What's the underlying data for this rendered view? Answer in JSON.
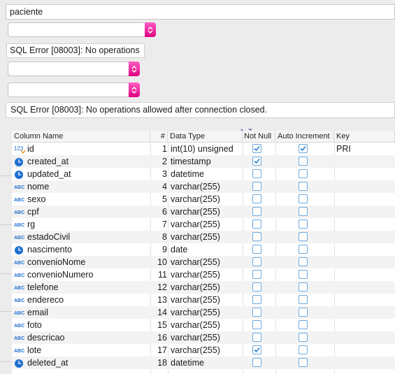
{
  "table_name_field": {
    "value": "paciente"
  },
  "combo1": {
    "value": ""
  },
  "error_short": {
    "text": "SQL Error [08003]: No operations"
  },
  "combo2": {
    "value": ""
  },
  "combo3": {
    "value": ""
  },
  "error_full": {
    "text": "SQL Error [08003]: No operations allowed after connection closed."
  },
  "grid": {
    "headers": {
      "name": "Column Name",
      "num": "#",
      "type": "Data Type",
      "not_null": "Not Null",
      "auto_increment": "Auto Increment",
      "key": "Key"
    },
    "rows": [
      {
        "name": "id",
        "num": "1",
        "type": "int(10) unsigned",
        "icon": "number-type-icon",
        "not_null": true,
        "auto_increment": true,
        "key": "PRI"
      },
      {
        "name": "created_at",
        "num": "2",
        "type": "timestamp",
        "icon": "clock-icon",
        "not_null": true,
        "auto_increment": false,
        "key": ""
      },
      {
        "name": "updated_at",
        "num": "3",
        "type": "datetime",
        "icon": "clock-icon",
        "not_null": false,
        "auto_increment": false,
        "key": ""
      },
      {
        "name": "nome",
        "num": "4",
        "type": "varchar(255)",
        "icon": "text-type-icon",
        "not_null": false,
        "auto_increment": false,
        "key": ""
      },
      {
        "name": "sexo",
        "num": "5",
        "type": "varchar(255)",
        "icon": "text-type-icon",
        "not_null": false,
        "auto_increment": false,
        "key": ""
      },
      {
        "name": "cpf",
        "num": "6",
        "type": "varchar(255)",
        "icon": "text-type-icon",
        "not_null": false,
        "auto_increment": false,
        "key": ""
      },
      {
        "name": "rg",
        "num": "7",
        "type": "varchar(255)",
        "icon": "text-type-icon",
        "not_null": false,
        "auto_increment": false,
        "key": ""
      },
      {
        "name": "estadoCivil",
        "num": "8",
        "type": "varchar(255)",
        "icon": "text-type-icon",
        "not_null": false,
        "auto_increment": false,
        "key": ""
      },
      {
        "name": "nascimento",
        "num": "9",
        "type": "date",
        "icon": "clock-icon",
        "not_null": false,
        "auto_increment": false,
        "key": ""
      },
      {
        "name": "convenioNome",
        "num": "10",
        "type": "varchar(255)",
        "icon": "text-type-icon",
        "not_null": false,
        "auto_increment": false,
        "key": ""
      },
      {
        "name": "convenioNumero",
        "num": "11",
        "type": "varchar(255)",
        "icon": "text-type-icon",
        "not_null": false,
        "auto_increment": false,
        "key": ""
      },
      {
        "name": "telefone",
        "num": "12",
        "type": "varchar(255)",
        "icon": "text-type-icon",
        "not_null": false,
        "auto_increment": false,
        "key": ""
      },
      {
        "name": "endereco",
        "num": "13",
        "type": "varchar(255)",
        "icon": "text-type-icon",
        "not_null": false,
        "auto_increment": false,
        "key": ""
      },
      {
        "name": "email",
        "num": "14",
        "type": "varchar(255)",
        "icon": "text-type-icon",
        "not_null": false,
        "auto_increment": false,
        "key": ""
      },
      {
        "name": "foto",
        "num": "15",
        "type": "varchar(255)",
        "icon": "text-type-icon",
        "not_null": false,
        "auto_increment": false,
        "key": ""
      },
      {
        "name": "descricao",
        "num": "16",
        "type": "varchar(255)",
        "icon": "text-type-icon",
        "not_null": false,
        "auto_increment": false,
        "key": ""
      },
      {
        "name": "lote",
        "num": "17",
        "type": "varchar(255)",
        "icon": "text-type-icon",
        "not_null": true,
        "auto_increment": false,
        "key": ""
      },
      {
        "name": "deleted_at",
        "num": "18",
        "type": "datetime",
        "icon": "clock-icon",
        "not_null": false,
        "auto_increment": false,
        "key": ""
      }
    ]
  },
  "colors": {
    "accent_pink": "#e6007e",
    "checkbox_blue": "#2f7fd6",
    "clock_blue": "#1f6fd0"
  }
}
